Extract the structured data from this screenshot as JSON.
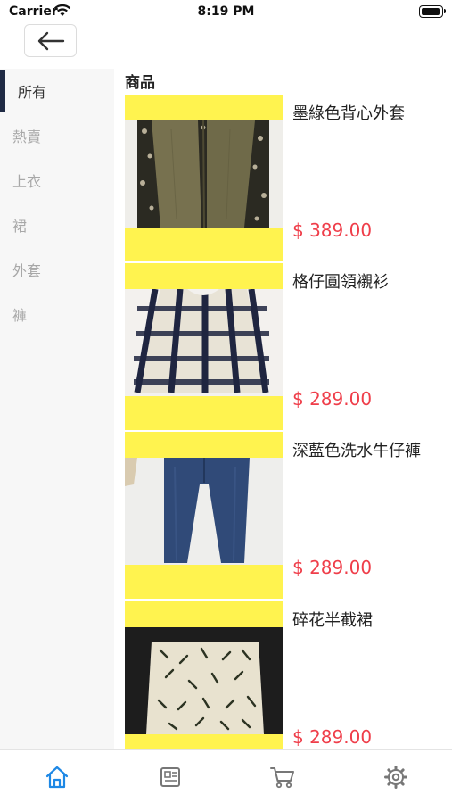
{
  "status_bar": {
    "carrier": "Carrier",
    "time": "8:19 PM"
  },
  "nav": {
    "back_icon": "arrow-left-icon"
  },
  "sidebar": {
    "categories": [
      {
        "label": "所有",
        "active": true
      },
      {
        "label": "熱賣",
        "active": false
      },
      {
        "label": "上衣",
        "active": false
      },
      {
        "label": "裙",
        "active": false
      },
      {
        "label": "外套",
        "active": false
      },
      {
        "label": "褲",
        "active": false
      }
    ]
  },
  "main": {
    "title": "商品",
    "products": [
      {
        "name": "墨綠色背心外套",
        "price": "$ 389.00"
      },
      {
        "name": "格仔圓領襯衫",
        "price": "$ 289.00"
      },
      {
        "name": "深藍色洗水牛仔褲",
        "price": "$ 289.00"
      },
      {
        "name": "碎花半截裙",
        "price": "$ 289.00"
      }
    ]
  },
  "tabbar": {
    "tabs": [
      {
        "icon": "home-icon",
        "active": true
      },
      {
        "icon": "news-icon",
        "active": false
      },
      {
        "icon": "cart-icon",
        "active": false
      },
      {
        "icon": "settings-icon",
        "active": false
      }
    ]
  },
  "colors": {
    "accent": "#1e88e5",
    "price": "#ef3e4a",
    "photo_bg": "#fff34f",
    "sidebar_bg": "#f7f7f7",
    "active_bar": "#1f2a44"
  }
}
